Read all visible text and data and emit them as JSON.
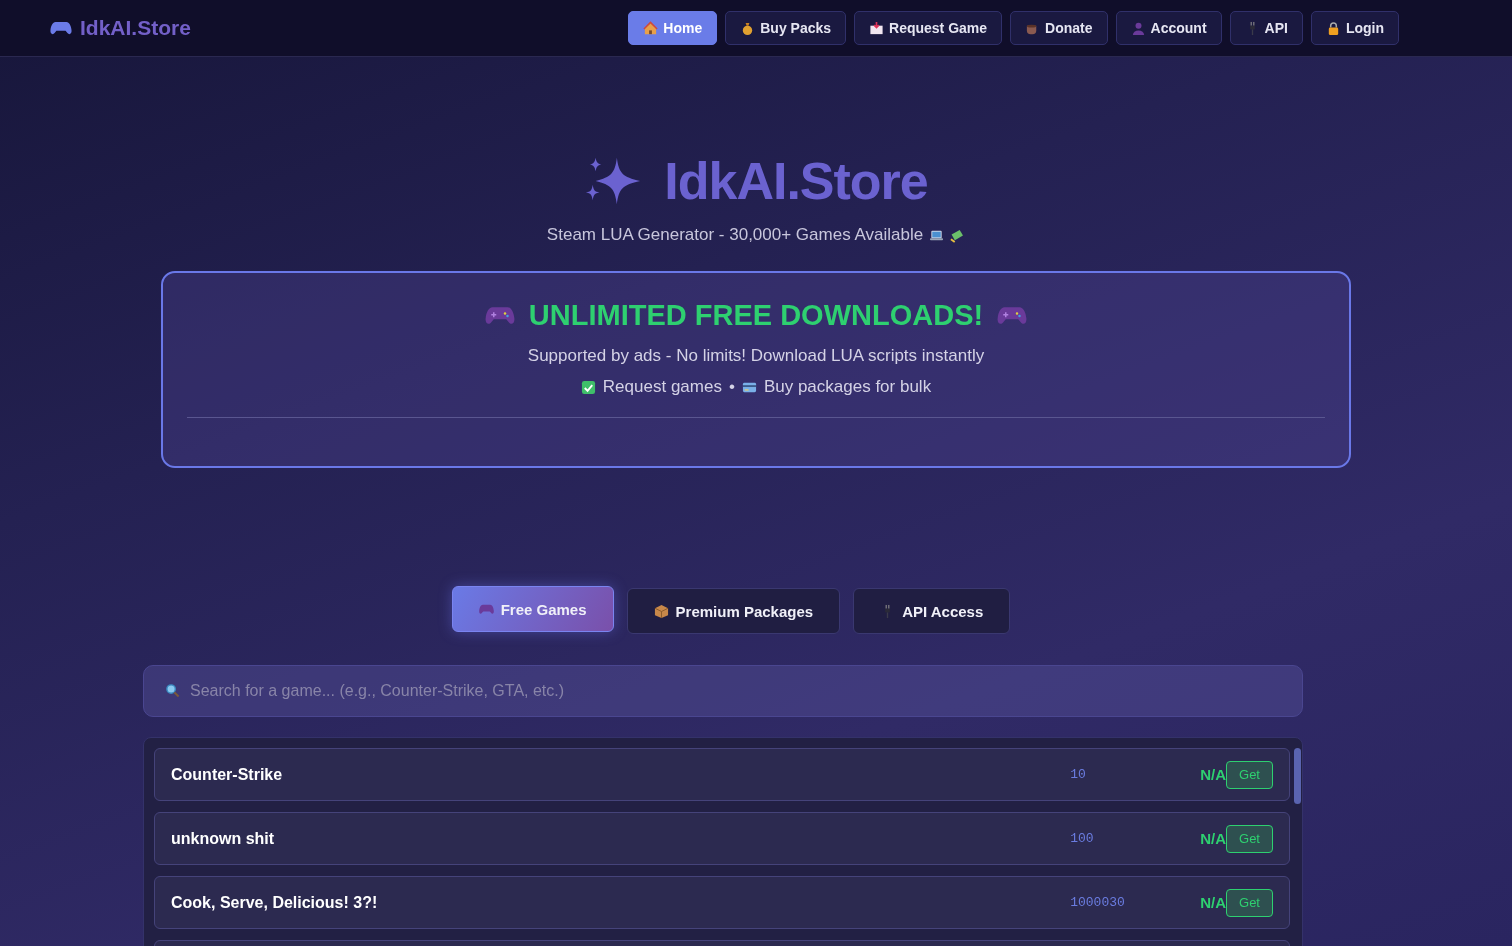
{
  "brand": {
    "name": "IdkAI.Store"
  },
  "nav": [
    {
      "label": "Home",
      "selected": true
    },
    {
      "label": "Buy Packs",
      "selected": false
    },
    {
      "label": "Request Game",
      "selected": false
    },
    {
      "label": "Donate",
      "selected": false
    },
    {
      "label": "Account",
      "selected": false
    },
    {
      "label": "API",
      "selected": false
    },
    {
      "label": "Login",
      "selected": false
    }
  ],
  "hero": {
    "title": "IdkAI.Store",
    "subtitle": "Steam LUA Generator - 30,000+ Games Available"
  },
  "banner": {
    "heading": "UNLIMITED FREE DOWNLOADS!",
    "text": "Supported by ads - No limits! Download LUA scripts instantly",
    "feature_1": "Request games",
    "separator": "•",
    "feature_2": "Buy packages for bulk"
  },
  "tabs": [
    {
      "label": "Free Games",
      "selected": true
    },
    {
      "label": "Premium Packages",
      "selected": false
    },
    {
      "label": "API Access",
      "selected": false
    }
  ],
  "search": {
    "placeholder": "Search for a game... (e.g., Counter-Strike, GTA, etc.)"
  },
  "games": [
    {
      "name": "Counter-Strike",
      "app_id": "10",
      "price": "N/A",
      "action": "Get"
    },
    {
      "name": "unknown shit",
      "app_id": "100",
      "price": "N/A",
      "action": "Get"
    },
    {
      "name": "Cook, Serve, Delicious! 3?!",
      "app_id": "1000030",
      "price": "N/A",
      "action": "Get"
    }
  ]
}
